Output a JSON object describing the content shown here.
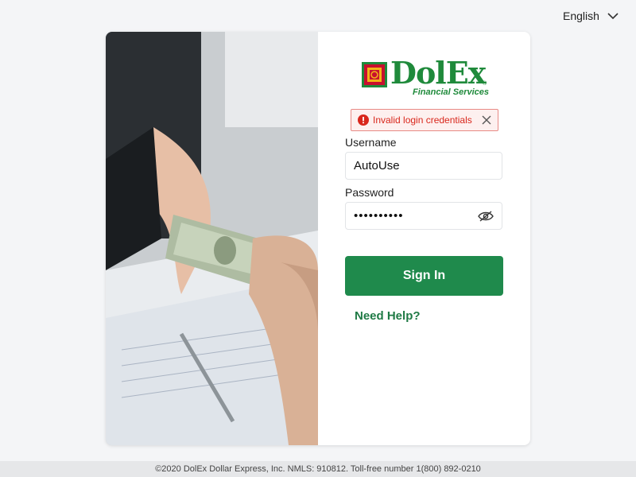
{
  "language": {
    "selected": "English"
  },
  "logo": {
    "brand": "DolEx",
    "tagline": "Financial Services",
    "registered": "®"
  },
  "alert": {
    "message": "Invalid login credentials"
  },
  "form": {
    "username_label": "Username",
    "username_value": "AutoUse",
    "password_label": "Password",
    "password_masked": "••••••••••",
    "signin_label": "Sign In",
    "help_label": "Need Help?"
  },
  "footer": {
    "text": "©2020 DolEx Dollar Express, Inc. NMLS: 910812.  Toll-free number 1(800) 892-0210"
  },
  "colors": {
    "brand_green": "#1f8a3b",
    "button_green": "#1f8a4c",
    "error_red": "#d9271c",
    "logo_red": "#c8102e",
    "logo_gold": "#f2b318"
  },
  "icons": {
    "language_dropdown": "chevron-down-icon",
    "alert": "error-icon",
    "alert_close": "close-icon",
    "password_toggle": "eye-slash-icon"
  }
}
